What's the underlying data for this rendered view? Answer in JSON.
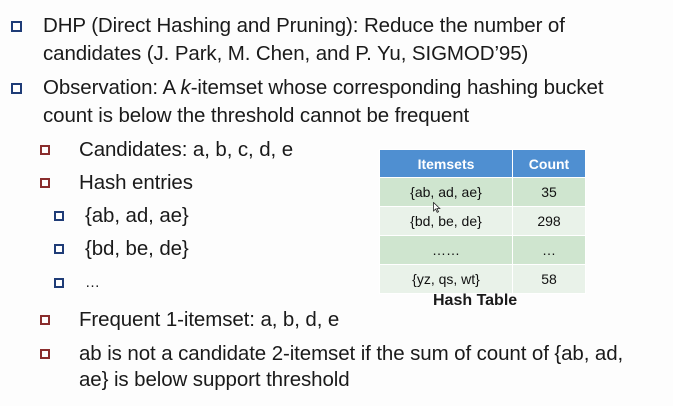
{
  "bullets": {
    "dhp_line1": "DHP (Direct Hashing and Pruning): Reduce the number of",
    "dhp_line2": "candidates  (J. Park, M. Chen, and P. Yu, SIGMOD’95)",
    "obs_line1_pre": "Observation:  A ",
    "obs_line1_k": "k",
    "obs_line1_post": "-itemset whose corresponding hashing bucket",
    "obs_line2": "count is below the threshold cannot be frequent",
    "candidates": "Candidates: a, b, c, d, e",
    "hash_entries": "Hash entries",
    "entry1": "{ab, ad, ae}",
    "entry2": "{bd, be, de}",
    "entry_more": "…",
    "frequent": "Frequent 1-itemset: a, b, d, e",
    "ab_line1": "ab is not a candidate 2-itemset if the sum of count of {ab, ad,",
    "ab_line2": "ae} is below support threshold"
  },
  "hash_table": {
    "headers": [
      "Itemsets",
      "Count"
    ],
    "rows": [
      [
        "{ab, ad, ae}",
        "35"
      ],
      [
        "{bd, be, de}",
        "298"
      ],
      [
        "……",
        "…"
      ],
      [
        "{yz, qs, wt}",
        "58"
      ]
    ],
    "caption": "Hash Table"
  },
  "colors": {
    "header_bg": "#4f8fd1",
    "row_dark": "#cfe5cf",
    "row_light": "#e9f2e9",
    "bullet_level1": "#1f3c77",
    "bullet_level2": "#8a2d2d"
  }
}
